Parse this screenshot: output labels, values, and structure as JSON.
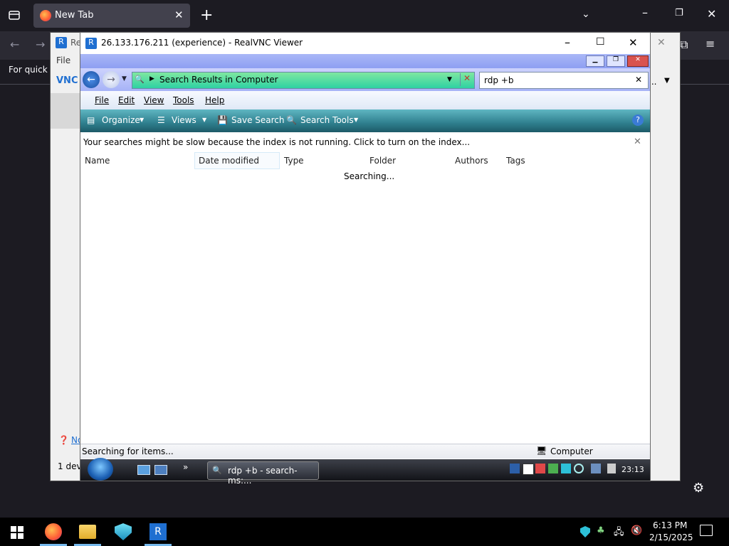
{
  "firefox": {
    "tab_title": "New Tab",
    "quick_access_text": "For quick a",
    "menu_file": "File",
    "book_title_partial": "Re",
    "vnc_brand_partial": "VNC",
    "book_note_partial": "No",
    "device_count_partial": "1 dev",
    "ellipsis": "..."
  },
  "vnc": {
    "title": "26.133.176.211 (experience) - RealVNC Viewer"
  },
  "explorer": {
    "address": "Search Results in Computer",
    "search_value": "rdp +b",
    "menu": [
      "File",
      "Edit",
      "View",
      "Tools",
      "Help"
    ],
    "commands": {
      "organize": "Organize",
      "views": "Views",
      "save_search": "Save Search",
      "search_tools": "Search Tools"
    },
    "info_bar": "Your searches might be slow because the index is not running.  Click to turn on the index...",
    "columns": [
      "Name",
      "Date modified",
      "Type",
      "Folder",
      "Authors",
      "Tags"
    ],
    "searching": "Searching...",
    "status_left": "Searching for items...",
    "status_right": "Computer"
  },
  "remote_taskbar": {
    "task_label": "rdp +b - search-ms:...",
    "clock": "23:13",
    "more": "»"
  },
  "host_taskbar": {
    "time": "6:13 PM",
    "date": "2/15/2025"
  },
  "colors": {
    "address_bar": "#3fdca0",
    "command_bar": "#2f7f8e",
    "vista_frame": "#9aa9f4"
  }
}
